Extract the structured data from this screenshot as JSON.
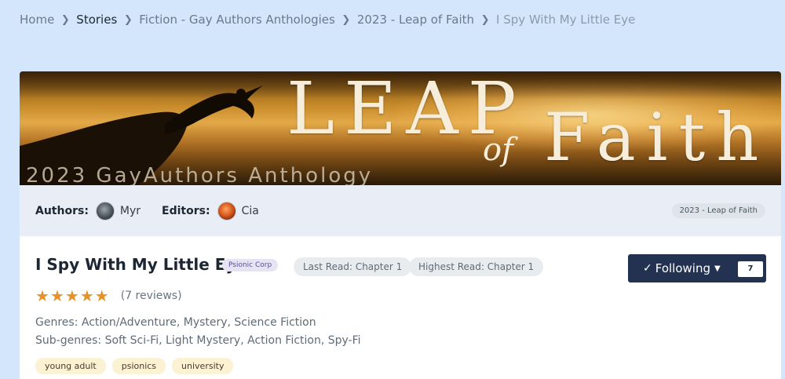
{
  "breadcrumb": {
    "items": [
      "Home",
      "Stories",
      "Fiction - Gay Authors Anthologies",
      "2023 - Leap of Faith",
      "I Spy With My Little Eye"
    ]
  },
  "banner": {
    "title_leap": "LEAP",
    "title_of": "of",
    "title_faith": "Faith",
    "subtitle": "2023 GayAuthors Anthology"
  },
  "authors_bar": {
    "authors_label": "Authors:",
    "author_name": "Myr",
    "editors_label": "Editors:",
    "editor_name": "Cia",
    "anthology_tag": "2023 - Leap of Faith"
  },
  "story": {
    "title": "I Spy With My Little Eye",
    "badge": "Psionic Corp",
    "last_read": "Last Read: Chapter 1",
    "highest_read": "Highest Read: Chapter 1",
    "follow_label": "Following",
    "follow_count": "7",
    "rating_stars": 5,
    "reviews": "(7 reviews)",
    "genres": "Genres: Action/Adventure, Mystery, Science Fiction",
    "subgenres": "Sub-genres: Soft Sci-Fi, Light Mystery, Action Fiction, Spy-Fi",
    "tags": [
      "young adult",
      "psionics",
      "university"
    ]
  },
  "colors": {
    "page_bg": "#d4e6fb",
    "follow_button": "#243251",
    "star": "#e5922b",
    "tag_bg": "#fbf1d3"
  }
}
